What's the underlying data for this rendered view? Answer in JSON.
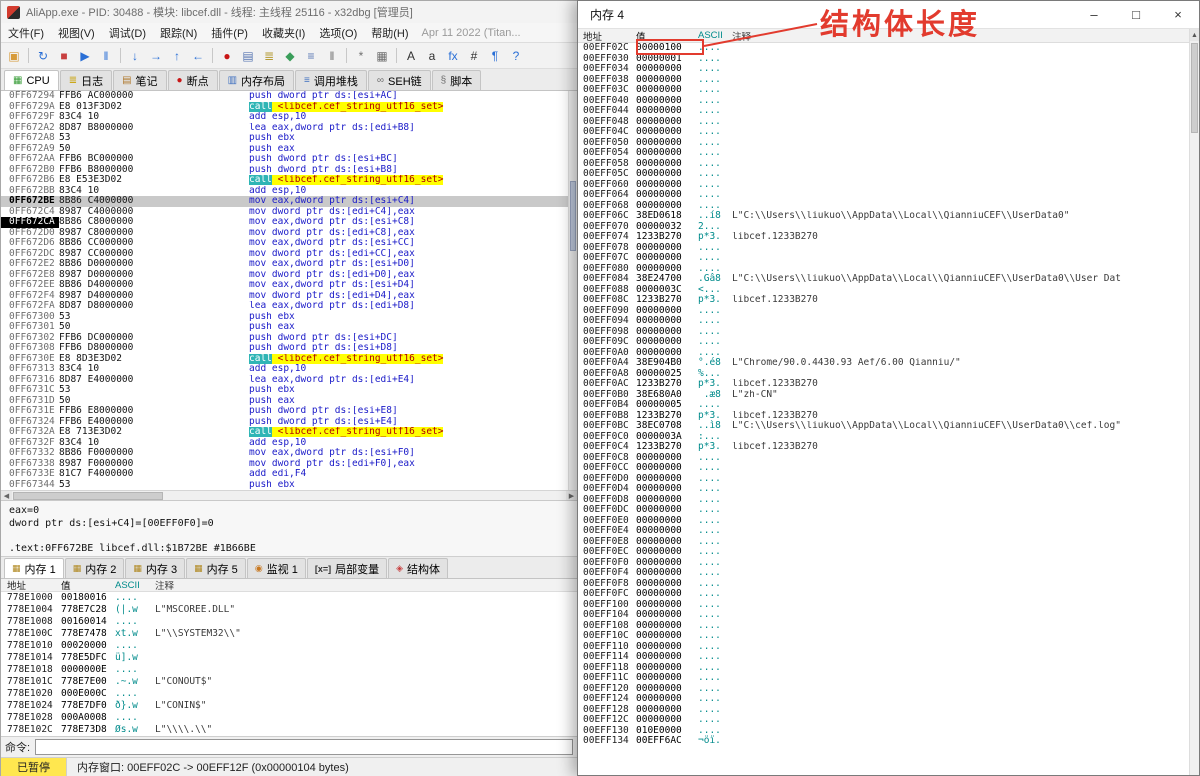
{
  "left_window": {
    "title": "AliApp.exe - PID: 30488 - 模块: libcef.dll - 线程: 主线程 25116 - x32dbg [管理员]",
    "menu": [
      "文件(F)",
      "视图(V)",
      "调试(D)",
      "跟踪(N)",
      "插件(P)",
      "收藏夹(I)",
      "选项(O)",
      "帮助(H)"
    ],
    "menu_date": "Apr 11 2022 (Titan...",
    "toolbar": [
      {
        "key": "open-file",
        "glyph": "▣",
        "color": "#d79b3a"
      },
      {
        "sep": true
      },
      {
        "key": "restart",
        "glyph": "↻",
        "color": "#2a6fd6"
      },
      {
        "key": "stop",
        "glyph": "■",
        "color": "#c84040"
      },
      {
        "key": "run",
        "glyph": "▶",
        "color": "#2a6fd6"
      },
      {
        "key": "pause",
        "glyph": "‖",
        "color": "#2a6fd6"
      },
      {
        "sep": true
      },
      {
        "key": "step-into",
        "glyph": "↓",
        "color": "#2a6fd6"
      },
      {
        "key": "step-over",
        "glyph": "→",
        "color": "#2a6fd6"
      },
      {
        "key": "step-out",
        "glyph": "↑",
        "color": "#2a6fd6"
      },
      {
        "key": "run-to-return",
        "glyph": "←",
        "color": "#2a6fd6"
      },
      {
        "sep": true
      },
      {
        "key": "breakpoints",
        "glyph": "●",
        "color": "#c81616"
      },
      {
        "key": "memory-map",
        "glyph": "▤",
        "color": "#5a78b4"
      },
      {
        "key": "log",
        "glyph": "≣",
        "color": "#b49a32"
      },
      {
        "key": "symbols",
        "glyph": "◆",
        "color": "#3a9e5a"
      },
      {
        "key": "references",
        "glyph": "≡",
        "color": "#5a78b4"
      },
      {
        "key": "threads",
        "glyph": "‖",
        "color": "#707070"
      },
      {
        "sep": true
      },
      {
        "key": "settings",
        "glyph": "*",
        "color": "#707070"
      },
      {
        "key": "calculator",
        "glyph": "▦",
        "color": "#707070"
      },
      {
        "sep": true
      },
      {
        "key": "highlight",
        "glyph": "A",
        "color": "#303030"
      },
      {
        "key": "font",
        "glyph": "a",
        "color": "#303030"
      },
      {
        "key": "fx",
        "glyph": "fx",
        "color": "#2a6fd6"
      },
      {
        "key": "hash",
        "glyph": "#",
        "color": "#303030"
      },
      {
        "key": "comment",
        "glyph": "¶",
        "color": "#2a6fd6"
      },
      {
        "key": "help",
        "glyph": "?",
        "color": "#2a6fd6"
      }
    ],
    "tabs": [
      {
        "key": "cpu",
        "label": "CPU",
        "glyph": "▦",
        "color": "#3a9e3a",
        "selected": true
      },
      {
        "key": "log",
        "label": "日志",
        "glyph": "≣",
        "color": "#c8a000"
      },
      {
        "key": "notes",
        "label": "笔记",
        "glyph": "▤",
        "color": "#b07a30"
      },
      {
        "key": "breakpoints",
        "label": "断点",
        "glyph": "●",
        "color": "#c81616"
      },
      {
        "key": "memory-map",
        "label": "内存布局",
        "glyph": "▥",
        "color": "#4070c0"
      },
      {
        "key": "call-stack",
        "label": "调用堆栈",
        "glyph": "≡",
        "color": "#4070c0"
      },
      {
        "key": "seh-chain",
        "label": "SEH链",
        "glyph": "∞",
        "color": "#707070"
      },
      {
        "key": "script",
        "label": "脚本",
        "glyph": "§",
        "color": "#707070"
      }
    ],
    "disasm_rows": [
      [
        "0FF67294",
        "FFB6 AC000000",
        "push dword ptr ds:[esi+AC]",
        ""
      ],
      [
        "0FF6729A",
        "E8 013F3D02",
        "call <libcef.cef_string_utf16_set>",
        "call"
      ],
      [
        "0FF6729F",
        "83C4 10",
        "add esp,10",
        ""
      ],
      [
        "0FF672A2",
        "8D87 B8000000",
        "lea eax,dword ptr ds:[edi+B8]",
        ""
      ],
      [
        "0FF672A8",
        "53",
        "push ebx",
        ""
      ],
      [
        "0FF672A9",
        "50",
        "push eax",
        ""
      ],
      [
        "0FF672AA",
        "FFB6 BC000000",
        "push dword ptr ds:[esi+BC]",
        ""
      ],
      [
        "0FF672B0",
        "FFB6 B8000000",
        "push dword ptr ds:[esi+B8]",
        ""
      ],
      [
        "0FF672B6",
        "E8 E53E3D02",
        "call <libcef.cef_string_utf16_set>",
        "call"
      ],
      [
        "0FF672BB",
        "83C4 10",
        "add esp,10",
        ""
      ],
      [
        "0FF672BE",
        "8B86 C4000000",
        "mov eax,dword ptr ds:[esi+C4]",
        "sel"
      ],
      [
        "0FF672C4",
        "8987 C4000000",
        "mov dword ptr ds:[edi+C4],eax",
        ""
      ],
      [
        "0FF672CA",
        "8B86 C8000000",
        "mov eax,dword ptr ds:[esi+C8]",
        "eip"
      ],
      [
        "0FF672D0",
        "8987 C8000000",
        "mov dword ptr ds:[edi+C8],eax",
        ""
      ],
      [
        "0FF672D6",
        "8B86 CC000000",
        "mov eax,dword ptr ds:[esi+CC]",
        ""
      ],
      [
        "0FF672DC",
        "8987 CC000000",
        "mov dword ptr ds:[edi+CC],eax",
        ""
      ],
      [
        "0FF672E2",
        "8B86 D0000000",
        "mov eax,dword ptr ds:[esi+D0]",
        ""
      ],
      [
        "0FF672E8",
        "8987 D0000000",
        "mov dword ptr ds:[edi+D0],eax",
        ""
      ],
      [
        "0FF672EE",
        "8B86 D4000000",
        "mov eax,dword ptr ds:[esi+D4]",
        ""
      ],
      [
        "0FF672F4",
        "8987 D4000000",
        "mov dword ptr ds:[edi+D4],eax",
        ""
      ],
      [
        "0FF672FA",
        "8D87 D8000000",
        "lea eax,dword ptr ds:[edi+D8]",
        ""
      ],
      [
        "0FF67300",
        "53",
        "push ebx",
        ""
      ],
      [
        "0FF67301",
        "50",
        "push eax",
        ""
      ],
      [
        "0FF67302",
        "FFB6 DC000000",
        "push dword ptr ds:[esi+DC]",
        ""
      ],
      [
        "0FF67308",
        "FFB6 D8000000",
        "push dword ptr ds:[esi+D8]",
        ""
      ],
      [
        "0FF6730E",
        "E8 8D3E3D02",
        "call <libcef.cef_string_utf16_set>",
        "call"
      ],
      [
        "0FF67313",
        "83C4 10",
        "add esp,10",
        ""
      ],
      [
        "0FF67316",
        "8D87 E4000000",
        "lea eax,dword ptr ds:[edi+E4]",
        ""
      ],
      [
        "0FF6731C",
        "53",
        "push ebx",
        ""
      ],
      [
        "0FF6731D",
        "50",
        "push eax",
        ""
      ],
      [
        "0FF6731E",
        "FFB6 E8000000",
        "push dword ptr ds:[esi+E8]",
        ""
      ],
      [
        "0FF67324",
        "FFB6 E4000000",
        "push dword ptr ds:[esi+E4]",
        ""
      ],
      [
        "0FF6732A",
        "E8 713E3D02",
        "call <libcef.cef_string_utf16_set>",
        "call"
      ],
      [
        "0FF6732F",
        "83C4 10",
        "add esp,10",
        ""
      ],
      [
        "0FF67332",
        "8B86 F0000000",
        "mov eax,dword ptr ds:[esi+F0]",
        ""
      ],
      [
        "0FF67338",
        "8987 F0000000",
        "mov dword ptr ds:[edi+F0],eax",
        ""
      ],
      [
        "0FF6733E",
        "81C7 F4000000",
        "add edi,F4",
        ""
      ],
      [
        "0FF67344",
        "53",
        "push ebx",
        ""
      ]
    ],
    "info_lines": [
      "eax=0",
      "dword ptr ds:[esi+C4]=[00EFF0F0]=0",
      ".text:0FF672BE libcef.dll:$1B72BE #1B66BE"
    ],
    "bottom_tabs": [
      {
        "key": "memory-1",
        "label": "内存 1",
        "glyph": "▦",
        "color": "#b08820",
        "selected": true
      },
      {
        "key": "memory-2",
        "label": "内存 2",
        "glyph": "▦",
        "color": "#b08820"
      },
      {
        "key": "memory-3",
        "label": "内存 3",
        "glyph": "▦",
        "color": "#b08820"
      },
      {
        "key": "memory-5",
        "label": "内存 5",
        "glyph": "▦",
        "color": "#b08820"
      },
      {
        "key": "watch-1",
        "label": "监视 1",
        "glyph": "◉",
        "color": "#c87820"
      },
      {
        "key": "locals",
        "label": "局部变量",
        "glyph": "[x=]",
        "color": "#303030"
      },
      {
        "key": "struct",
        "label": "结构体",
        "glyph": "◈",
        "color": "#c84040"
      }
    ],
    "dump_headers": [
      "地址",
      "值",
      "ASCII",
      "注释"
    ],
    "dump_rows": [
      [
        "778E1000",
        "00180016",
        "....",
        ""
      ],
      [
        "778E1004",
        "778E7C28",
        "(|.w",
        "L\"MSCOREE.DLL\""
      ],
      [
        "778E1008",
        "00160014",
        "....",
        ""
      ],
      [
        "778E100C",
        "778E7478",
        "xt.w",
        "L\"\\\\SYSTEM32\\\\\""
      ],
      [
        "778E1010",
        "00020000",
        "....",
        ""
      ],
      [
        "778E1014",
        "778E5DFC",
        "ü].w",
        ""
      ],
      [
        "778E1018",
        "0000000E",
        "....",
        ""
      ],
      [
        "778E101C",
        "778E7E00",
        ".~.w",
        "L\"CONOUT$\""
      ],
      [
        "778E1020",
        "000E000C",
        "....",
        ""
      ],
      [
        "778E1024",
        "778E7DF0",
        "ð}.w",
        "L\"CONIN$\""
      ],
      [
        "778E1028",
        "000A0008",
        "....",
        ""
      ],
      [
        "778E102C",
        "778E73D8",
        "Øs.w",
        "L\"\\\\\\\\.\\\\\""
      ]
    ],
    "command_label": "命令:",
    "status_state": "已暂停",
    "status_message": "内存窗口: 00EFF02C -> 00EFF12F (0x00000104 bytes)"
  },
  "memory_window": {
    "title": "内存 4",
    "controls": [
      {
        "key": "minimize",
        "glyph": "–"
      },
      {
        "key": "maximize",
        "glyph": "□"
      },
      {
        "key": "close",
        "glyph": "×"
      }
    ],
    "headers": [
      "地址",
      "值",
      "ASCII",
      "注释"
    ],
    "rows": [
      [
        "00EFF02C",
        "00000100",
        "....",
        ""
      ],
      [
        "00EFF030",
        "00000001",
        "....",
        ""
      ],
      [
        "00EFF034",
        "00000000",
        "....",
        ""
      ],
      [
        "00EFF038",
        "00000000",
        "....",
        ""
      ],
      [
        "00EFF03C",
        "00000000",
        "....",
        ""
      ],
      [
        "00EFF040",
        "00000000",
        "....",
        ""
      ],
      [
        "00EFF044",
        "00000000",
        "....",
        ""
      ],
      [
        "00EFF048",
        "00000000",
        "....",
        ""
      ],
      [
        "00EFF04C",
        "00000000",
        "....",
        ""
      ],
      [
        "00EFF050",
        "00000000",
        "....",
        ""
      ],
      [
        "00EFF054",
        "00000000",
        "....",
        ""
      ],
      [
        "00EFF058",
        "00000000",
        "....",
        ""
      ],
      [
        "00EFF05C",
        "00000000",
        "....",
        ""
      ],
      [
        "00EFF060",
        "00000000",
        "....",
        ""
      ],
      [
        "00EFF064",
        "00000000",
        "....",
        ""
      ],
      [
        "00EFF068",
        "00000000",
        "....",
        ""
      ],
      [
        "00EFF06C",
        "38ED0618",
        "..í8",
        "L\"C:\\\\Users\\\\liukuo\\\\AppData\\\\Local\\\\QianniuCEF\\\\UserData0\""
      ],
      [
        "00EFF070",
        "00000032",
        "2...",
        ""
      ],
      [
        "00EFF074",
        "1233B270",
        "p*3.",
        "libcef.1233B270"
      ],
      [
        "00EFF078",
        "00000000",
        "....",
        ""
      ],
      [
        "00EFF07C",
        "00000000",
        "....",
        ""
      ],
      [
        "00EFF080",
        "00000000",
        "....",
        ""
      ],
      [
        "00EFF084",
        "38E24700",
        ".Gâ8",
        "L\"C:\\\\Users\\\\liukuo\\\\AppData\\\\Local\\\\QianniuCEF\\\\UserData0\\\\User Dat"
      ],
      [
        "00EFF088",
        "0000003C",
        "<...",
        ""
      ],
      [
        "00EFF08C",
        "1233B270",
        "p*3.",
        "libcef.1233B270"
      ],
      [
        "00EFF090",
        "00000000",
        "....",
        ""
      ],
      [
        "00EFF094",
        "00000000",
        "....",
        ""
      ],
      [
        "00EFF098",
        "00000000",
        "....",
        ""
      ],
      [
        "00EFF09C",
        "00000000",
        "....",
        ""
      ],
      [
        "00EFF0A0",
        "00000000",
        "....",
        ""
      ],
      [
        "00EFF0A4",
        "38E904B0",
        "°.é8",
        "L\"Chrome/90.0.4430.93 Aef/6.00 Qianniu/\""
      ],
      [
        "00EFF0A8",
        "00000025",
        "%...",
        ""
      ],
      [
        "00EFF0AC",
        "1233B270",
        "p*3.",
        "libcef.1233B270"
      ],
      [
        "00EFF0B0",
        "38E680A0",
        " .æ8",
        "L\"zh-CN\""
      ],
      [
        "00EFF0B4",
        "00000005",
        "....",
        ""
      ],
      [
        "00EFF0B8",
        "1233B270",
        "p*3.",
        "libcef.1233B270"
      ],
      [
        "00EFF0BC",
        "38EC0708",
        "..ì8",
        "L\"C:\\\\Users\\\\liukuo\\\\AppData\\\\Local\\\\QianniuCEF\\\\UserData0\\\\cef.log\""
      ],
      [
        "00EFF0C0",
        "0000003A",
        ":...",
        ""
      ],
      [
        "00EFF0C4",
        "1233B270",
        "p*3.",
        "libcef.1233B270"
      ],
      [
        "00EFF0C8",
        "00000000",
        "....",
        ""
      ],
      [
        "00EFF0CC",
        "00000000",
        "....",
        ""
      ],
      [
        "00EFF0D0",
        "00000000",
        "....",
        ""
      ],
      [
        "00EFF0D4",
        "00000000",
        "....",
        ""
      ],
      [
        "00EFF0D8",
        "00000000",
        "....",
        ""
      ],
      [
        "00EFF0DC",
        "00000000",
        "....",
        ""
      ],
      [
        "00EFF0E0",
        "00000000",
        "....",
        ""
      ],
      [
        "00EFF0E4",
        "00000000",
        "....",
        ""
      ],
      [
        "00EFF0E8",
        "00000000",
        "....",
        ""
      ],
      [
        "00EFF0EC",
        "00000000",
        "....",
        ""
      ],
      [
        "00EFF0F0",
        "00000000",
        "....",
        ""
      ],
      [
        "00EFF0F4",
        "00000000",
        "....",
        ""
      ],
      [
        "00EFF0F8",
        "00000000",
        "....",
        ""
      ],
      [
        "00EFF0FC",
        "00000000",
        "....",
        ""
      ],
      [
        "00EFF100",
        "00000000",
        "....",
        ""
      ],
      [
        "00EFF104",
        "00000000",
        "....",
        ""
      ],
      [
        "00EFF108",
        "00000000",
        "....",
        ""
      ],
      [
        "00EFF10C",
        "00000000",
        "....",
        ""
      ],
      [
        "00EFF110",
        "00000000",
        "....",
        ""
      ],
      [
        "00EFF114",
        "00000000",
        "....",
        ""
      ],
      [
        "00EFF118",
        "00000000",
        "....",
        ""
      ],
      [
        "00EFF11C",
        "00000000",
        "....",
        ""
      ],
      [
        "00EFF120",
        "00000000",
        "....",
        ""
      ],
      [
        "00EFF124",
        "00000000",
        "....",
        ""
      ],
      [
        "00EFF128",
        "00000000",
        "....",
        ""
      ],
      [
        "00EFF12C",
        "00000000",
        "....",
        ""
      ],
      [
        "00EFF130",
        "010E0000",
        "....",
        ""
      ],
      [
        "00EFF134",
        "00EFF6AC",
        "¬öï.",
        ""
      ]
    ]
  },
  "annotation": {
    "label": "结构体长度",
    "color": "#e23b2e"
  }
}
